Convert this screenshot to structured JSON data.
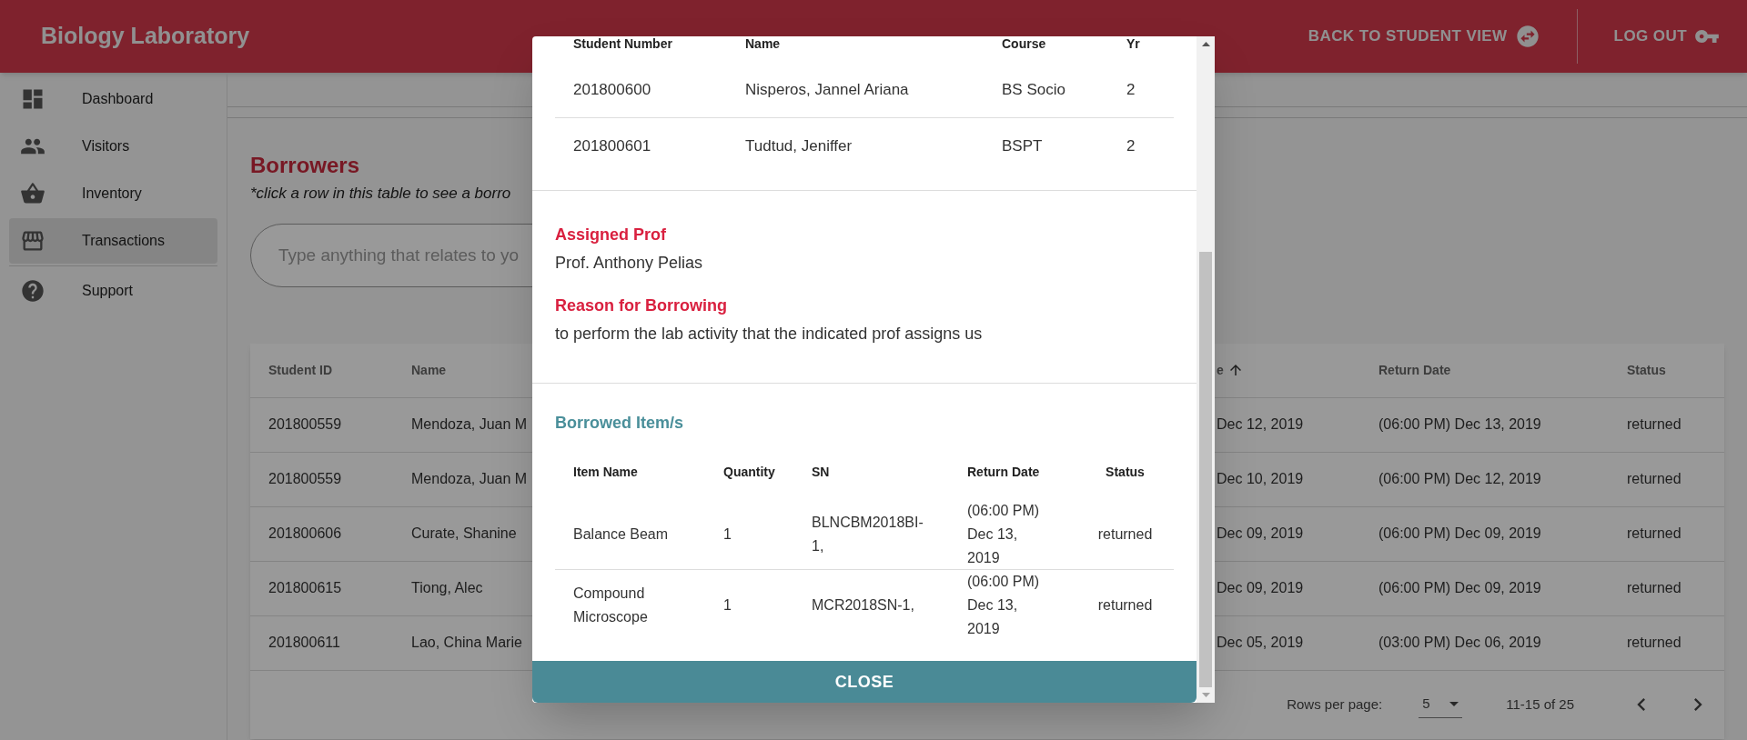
{
  "app_bar": {
    "title": "Biology Laboratory",
    "actions": [
      {
        "label": "BACK TO STUDENT VIEW",
        "kind": "swap"
      },
      {
        "label": "LOG OUT",
        "kind": "key"
      }
    ]
  },
  "sidebar": {
    "items": [
      {
        "label": "Dashboard",
        "kind": "dashboard",
        "selected": false
      },
      {
        "label": "Visitors",
        "kind": "people",
        "selected": false
      },
      {
        "label": "Inventory",
        "kind": "basket",
        "selected": false
      },
      {
        "label": "Transactions",
        "kind": "store",
        "selected": true
      },
      {
        "label": "Support",
        "kind": "help",
        "selected": false
      }
    ]
  },
  "page": {
    "heading": "Borrowers",
    "hint": "*click a row in this table to see a borro",
    "search": {
      "placeholder": "Type anything that relates to yo"
    }
  },
  "table": {
    "columns": [
      {
        "label": "Student ID",
        "sorted": false
      },
      {
        "label": "Name",
        "sorted": false
      },
      {
        "label": "e",
        "sorted": true
      },
      {
        "label": "Return Date",
        "sorted": false
      },
      {
        "label": "Status",
        "sorted": false
      }
    ],
    "rows": [
      [
        "201800559",
        "Mendoza, Juan M",
        "Dec 12, 2019",
        "(06:00 PM) Dec 13, 2019",
        "returned"
      ],
      [
        "201800559",
        "Mendoza, Juan M",
        "Dec 10, 2019",
        "(06:00 PM) Dec 12, 2019",
        "returned"
      ],
      [
        "201800606",
        "Curate, Shanine",
        "Dec 09, 2019",
        "(06:00 PM) Dec 09, 2019",
        "returned"
      ],
      [
        "201800615",
        "Tiong, Alec",
        "Dec 09, 2019",
        "(06:00 PM) Dec 09, 2019",
        "returned"
      ],
      [
        "201800611",
        "Lao, China Marie",
        "Dec 05, 2019",
        "(03:00 PM) Dec 06, 2019",
        "returned"
      ]
    ],
    "pagination": {
      "rows_per_page_label": "Rows per page:",
      "rows_per_page": "5",
      "range": "11-15 of 25"
    }
  },
  "dialog": {
    "students": {
      "columns": [
        "Student Number",
        "Name",
        "Course",
        "Yr"
      ],
      "rows": [
        [
          "201800600",
          "Nisperos, Jannel Ariana",
          "BS Socio",
          "2"
        ],
        [
          "201800601",
          "Tudtud, Jeniffer",
          "BSPT",
          "2"
        ]
      ]
    },
    "assigned_prof": {
      "label": "Assigned Prof",
      "value": "Prof. Anthony Pelias"
    },
    "reason": {
      "label": "Reason for Borrowing",
      "value": "to perform the lab activity that the indicated prof assigns us"
    },
    "items": {
      "title": "Borrowed Item/s",
      "columns": [
        "Item Name",
        "Quantity",
        "SN",
        "Return Date",
        "Status"
      ],
      "rows": [
        [
          "Balance Beam",
          "1",
          "BLNCBM2018BI-1,",
          "(06:00 PM) Dec 13, 2019",
          "returned"
        ],
        [
          "Compound Microscope",
          "1",
          "MCR2018SN-1,",
          "(06:00 PM) Dec 13, 2019",
          "returned"
        ]
      ]
    },
    "close_button": "CLOSE"
  }
}
